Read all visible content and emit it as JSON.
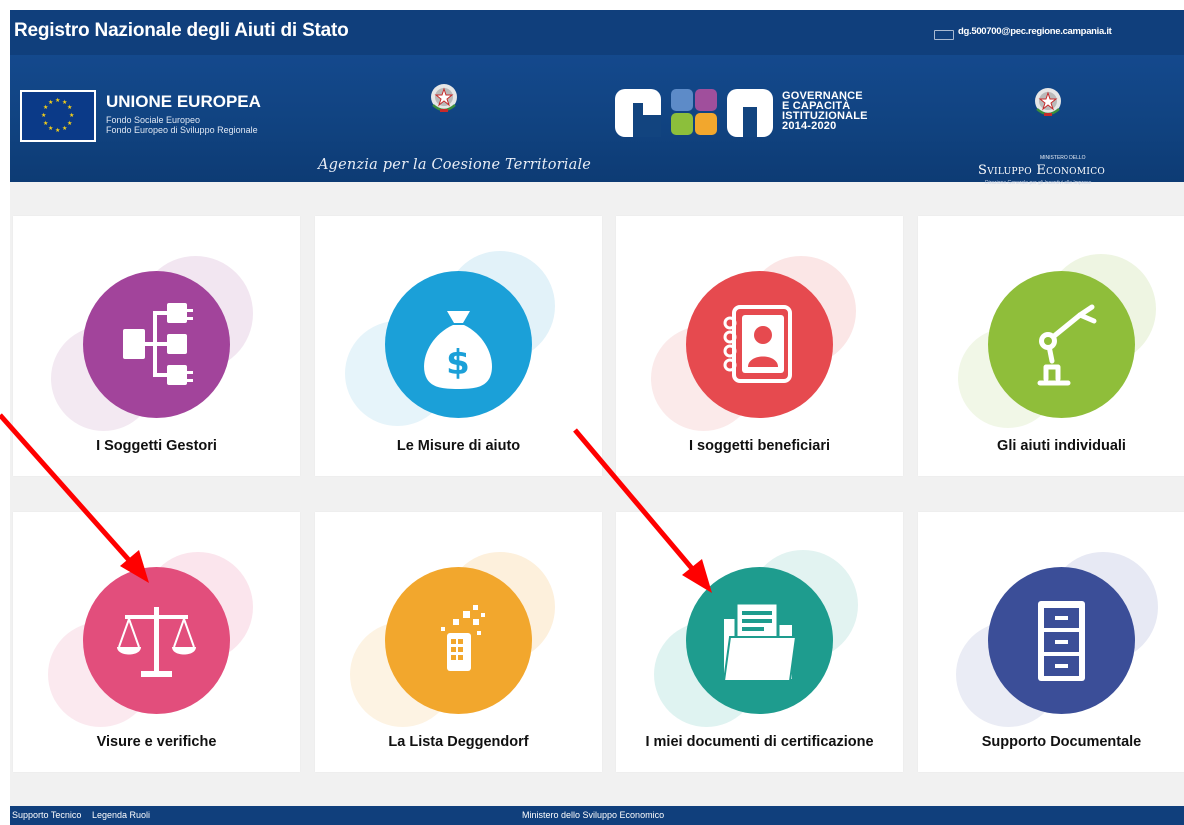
{
  "header": {
    "title": "Registro Nazionale degli Aiuti di Stato",
    "user_email": "dg.500700@pec.regione.campania.it"
  },
  "banner": {
    "eu_title": "UNIONE EUROPEA",
    "eu_line1": "Fondo Sociale Europeo",
    "eu_line2": "Fondo Europeo di Sviluppo Regionale",
    "agenzia": "Agenzia per la Coesione Territoriale",
    "pon_logo": "PON",
    "pon_lines": [
      "GOVERNANCE",
      "E CAPACITÀ",
      "ISTITUZIONALE",
      "2014-2020"
    ],
    "ministero_small": "MINISTERO DELLO",
    "ministero_name": "Sviluppo Economico",
    "ministero_sub": "Direzione Generale per gli Incentivi alle Imprese"
  },
  "tiles": [
    {
      "label": "I Soggetti Gestori",
      "icon": "hierarchy-icon",
      "color": "#a2449b"
    },
    {
      "label": "Le Misure di aiuto",
      "icon": "money-bag-icon",
      "color": "#1ba0d8"
    },
    {
      "label": "I soggetti beneficiari",
      "icon": "address-book-icon",
      "color": "#e64a4f"
    },
    {
      "label": "Gli aiuti individuali",
      "icon": "robot-arm-icon",
      "color": "#8fbe3a"
    },
    {
      "label": "Visure e verifiche",
      "icon": "scales-icon",
      "color": "#e24e7c"
    },
    {
      "label": "La Lista Deggendorf",
      "icon": "tablet-icon",
      "color": "#f2a72d"
    },
    {
      "label": "I miei documenti di certificazione",
      "icon": "folder-icon",
      "color": "#1e9c8e"
    },
    {
      "label": "Supporto Documentale",
      "icon": "file-cabinet-icon",
      "color": "#3b4e98"
    }
  ],
  "footer": {
    "link1": "Supporto Tecnico",
    "link2": "Legenda Ruoli",
    "center": "Ministero dello Sviluppo Economico"
  },
  "annotations": {
    "arrow_color": "#ff0000"
  }
}
